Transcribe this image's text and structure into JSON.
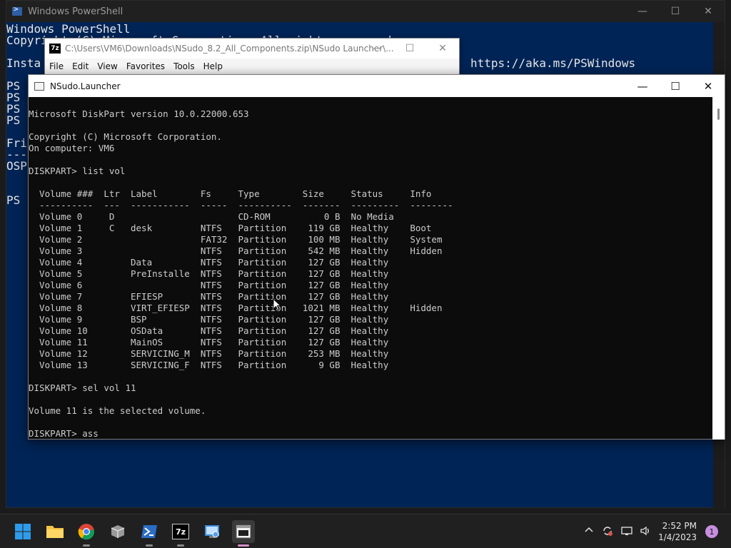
{
  "powershell": {
    "title": "Windows PowerShell",
    "lines": [
      "Windows PowerShell",
      "Copyright (C) Microsoft Corporation. All rights reserved.",
      "Insta",
      "PS",
      "PS",
      "PS",
      "PS",
      "Fri",
      "---",
      "OSP",
      "PS"
    ],
    "link": "https://aka.ms/PSWindows"
  },
  "zip": {
    "title": "C:\\Users\\VM6\\Downloads\\NSudo_8.2_All_Components.zip\\NSudo Launcher\\...",
    "icon_label": "7z",
    "menu": [
      "File",
      "Edit",
      "View",
      "Favorites",
      "Tools",
      "Help"
    ]
  },
  "nsudo": {
    "title": "NSudo.Launcher",
    "console_lines": [
      "Microsoft DiskPart version 10.0.22000.653",
      "",
      "Copyright (C) Microsoft Corporation.",
      "On computer: VM6",
      "",
      "DISKPART> list vol",
      "",
      "  Volume ###  Ltr  Label        Fs     Type        Size     Status     Info",
      "  ----------  ---  -----------  -----  ----------  -------  ---------  --------",
      "  Volume 0     D                       CD-ROM          0 B  No Media",
      "  Volume 1     C   desk         NTFS   Partition    119 GB  Healthy    Boot",
      "  Volume 2                      FAT32  Partition    100 MB  Healthy    System",
      "  Volume 3                      NTFS   Partition    542 MB  Healthy    Hidden",
      "  Volume 4         Data         NTFS   Partition    127 GB  Healthy",
      "  Volume 5         PreInstalle  NTFS   Partition    127 GB  Healthy",
      "  Volume 6                      NTFS   Partition    127 GB  Healthy",
      "  Volume 7         EFIESP       NTFS   Partition    127 GB  Healthy",
      "  Volume 8         VIRT_EFIESP  NTFS   Partition   1021 MB  Healthy    Hidden",
      "  Volume 9         BSP          NTFS   Partition    127 GB  Healthy",
      "  Volume 10        OSData       NTFS   Partition    127 GB  Healthy",
      "  Volume 11        MainOS       NTFS   Partition    127 GB  Healthy",
      "  Volume 12        SERVICING_M  NTFS   Partition    253 MB  Healthy",
      "  Volume 13        SERVICING_F  NTFS   Partition      9 GB  Healthy",
      "",
      "DISKPART> sel vol 11",
      "",
      "Volume 11 is the selected volume.",
      "",
      "DISKPART> ass"
    ]
  },
  "caption": {
    "minimize": "—",
    "maximize": "☐",
    "close": "✕"
  },
  "taskbar": {
    "apps": [
      "start",
      "file-explorer",
      "chrome",
      "package",
      "powershell",
      "7zip",
      "control-panel",
      "nsudo-launcher"
    ],
    "zip_icon_label": "7z",
    "clock_time": "2:52 PM",
    "clock_date": "1/4/2023",
    "notification_count": "1"
  }
}
